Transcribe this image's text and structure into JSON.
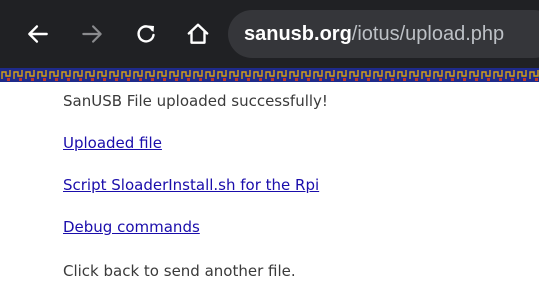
{
  "browser": {
    "url_host": "sanusb.org",
    "url_path": "/iotus/upload.php",
    "icons": [
      "back-arrow-icon",
      "forward-arrow-icon",
      "reload-icon",
      "home-icon"
    ],
    "toolbar_color": "#202124",
    "omnibox_color": "#35363a"
  },
  "page": {
    "message": "SanUSB File uploaded successfully!",
    "links": [
      {
        "label": "Uploaded file"
      },
      {
        "label": "Script SloaderInstall.sh for the Rpi"
      },
      {
        "label": "Debug commands"
      }
    ],
    "back_text": "Click back to send another file.",
    "link_color": "#1a0dab",
    "banner_colors": [
      "#1e2a8a",
      "#c0392b",
      "#d4a017"
    ]
  }
}
